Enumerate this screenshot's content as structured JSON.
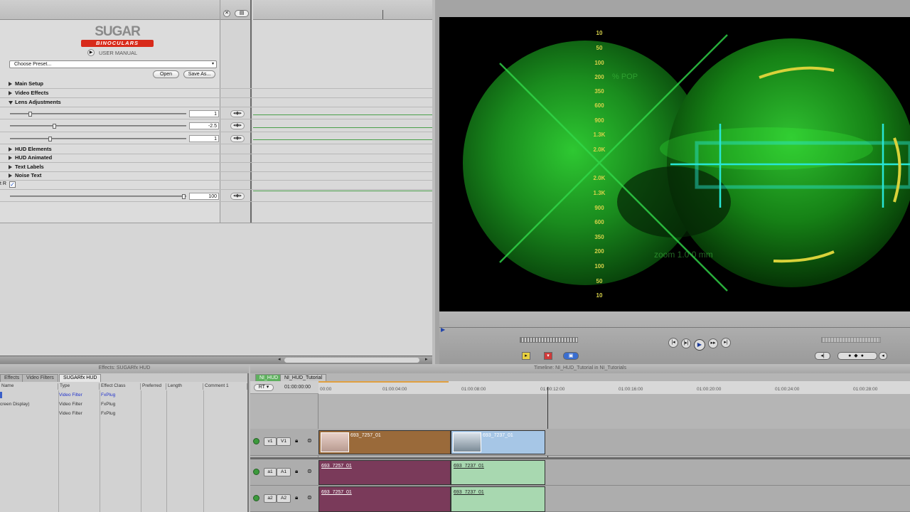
{
  "filter": {
    "brand": "SUGAR",
    "product": "Binoculars",
    "user_manual": "USER MANUAL",
    "preset": "Choose Preset...",
    "open": "Open",
    "save_as": "Save As...",
    "groups": [
      "Main Setup",
      "Video Effects",
      "Lens Adjustments",
      "HUD Elements",
      "HUD Animated",
      "Text Labels",
      "Noise Text"
    ],
    "lens_values": [
      "1",
      "-2.5",
      "1"
    ],
    "last_value": "100",
    "checkbox_label": "t R"
  },
  "viewer": {
    "scale_top": [
      "10",
      "50",
      "100",
      "200",
      "350",
      "600",
      "900",
      "1.3K",
      "2.0K"
    ],
    "scale_bottom": [
      "2.0K",
      "1.3K",
      "900",
      "600",
      "350",
      "200",
      "100",
      "50",
      "10"
    ],
    "faint_pop": "% POP",
    "faint_zoom": "zoom 1.0 0 mm"
  },
  "browser": {
    "title": "Effects: SUGARfx HUD",
    "tabs": [
      "Effects",
      "Video Filters",
      "SUGARfx HUD"
    ],
    "columns": [
      "Name",
      "Type",
      "Effect Class",
      "Preferred",
      "Length",
      "Comment 1"
    ],
    "rows": [
      {
        "name": "",
        "type": "Video Filter",
        "class": "FxPlug"
      },
      {
        "name": "creen Display)",
        "type": "Video Filter",
        "class": "FxPlug"
      },
      {
        "name": "",
        "type": "Video Filter",
        "class": "FxPlug"
      }
    ]
  },
  "timeline": {
    "title": "Timeline: NI_HUD_Tutorial in NI_Tutorials",
    "tabs": [
      "NI_HUD",
      "NI_HUD_Tutorial"
    ],
    "rt": "RT",
    "timecode": "01:00:00:00",
    "ruler": [
      "00:00",
      "01:00:04:00",
      "01:00:08:00",
      "01:00:12:00",
      "01:00:16:00",
      "01:00:20:00",
      "01:00:24:00",
      "01:00:28:00"
    ],
    "tracks": [
      {
        "src": "v1",
        "dst": "V1"
      },
      {
        "src": "a1",
        "dst": "A1"
      },
      {
        "src": "a2",
        "dst": "A2"
      }
    ],
    "clip_a": "693_7257_01",
    "clip_b": "693_7237_01"
  }
}
